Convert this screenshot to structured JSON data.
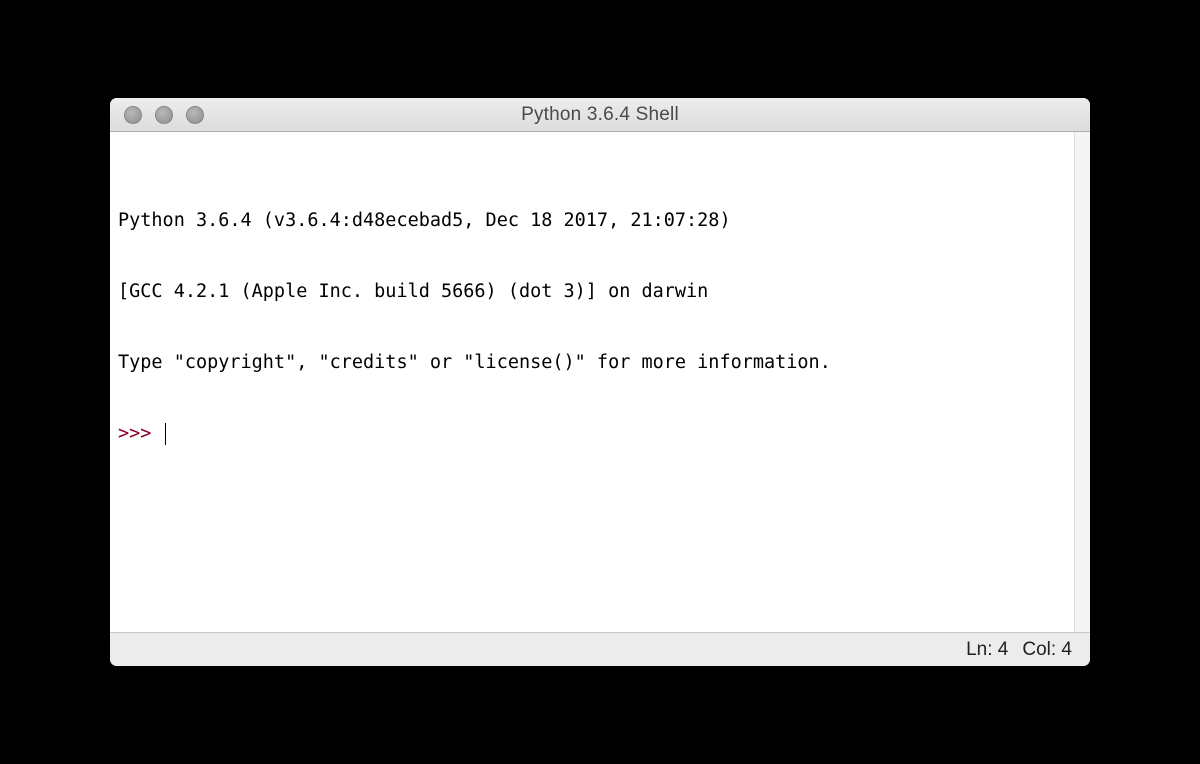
{
  "window": {
    "title": "Python 3.6.4 Shell"
  },
  "content": {
    "line1": "Python 3.6.4 (v3.6.4:d48ecebad5, Dec 18 2017, 21:07:28) ",
    "line2": "[GCC 4.2.1 (Apple Inc. build 5666) (dot 3)] on darwin",
    "line3": "Type \"copyright\", \"credits\" or \"license()\" for more information.",
    "prompt": ">>> "
  },
  "status": {
    "line": "Ln: 4",
    "col": "Col: 4"
  }
}
